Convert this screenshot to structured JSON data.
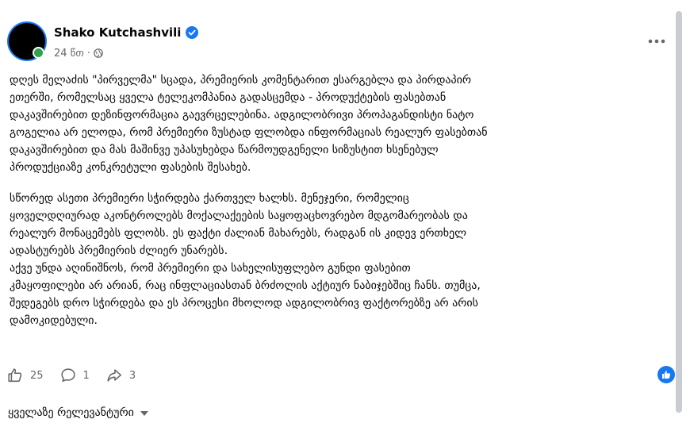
{
  "author": {
    "name": "Shako Kutchashvili",
    "verified_icon": "verified-badge-icon"
  },
  "meta": {
    "time": "24 წთ",
    "separator": "·",
    "audience_icon": "globe-icon"
  },
  "paragraphs": [
    [
      "დღეს მელაძის  \"პირველმა\"  სცადა, პრემიერის კომენტარით ესარგებლა და პირდაპირ",
      "ეთერში, რომელსაც ყველა ტელეკომპანია გადასცემდა - პროდუქტების ფასებთან",
      "დაკავშირებით დეზინფორმაცია გაევრცელებინა. ადგილობრივი პროპაგანდისტი ნატო",
      "გოგელია არ ელოდა, რომ პრემიერი ზუსტად ფლობდა ინფორმაციას რეალურ ფასებთან",
      "დაკავშირებით და მას მაშინვე უპასუხებდა წარმოუდგენელი სიზუსტით ხსენებულ",
      "პროდუქციაზე კონკრეტული ფასების შესახებ."
    ],
    [
      "სწორედ ასეთი პრემიერი სჭირდება ქართველ ხალხს. მენეჯერი, რომელიც",
      "ყოველდღიურად აკონტროლებს მოქალაქეების საყოფაცხოვრებო მდგომარეობას და",
      "რეალურ მონაცემებს ფლობს. ეს ფაქტი ძალიან მახარებს, რადგან ის კიდევ ერთხელ",
      "ადასტურებს პრემიერის ძლიერ უნარებს.",
      "აქვე უნდა აღინიშნოს, რომ პრემიერი და სახელისუფლებო გუნდი ფასებით",
      "კმაყოფილები არ არიან, რაც ინფლაციასთან ბრძოლის აქტიურ ნაბიჯებშიც ჩანს. თუმცა,",
      "შედეგებს დრო სჭირდება და ეს პროცესი მხოლოდ ადგილობრივ ფაქტორებზე არ არის",
      "დამოკიდებული."
    ]
  ],
  "actions": {
    "like_count": "25",
    "like_icon": "thumbs-up-icon",
    "comment_count": "1",
    "comment_icon": "comment-bubble-icon",
    "share_count": "3",
    "share_icon": "share-arrow-icon"
  },
  "reaction_icon": "like-reaction-icon",
  "comments_filter": {
    "label": "ყველაზე რელევანტური"
  },
  "colors": {
    "accent": "#1877f2",
    "secondary_text": "#65676b",
    "online": "#31a24c"
  }
}
